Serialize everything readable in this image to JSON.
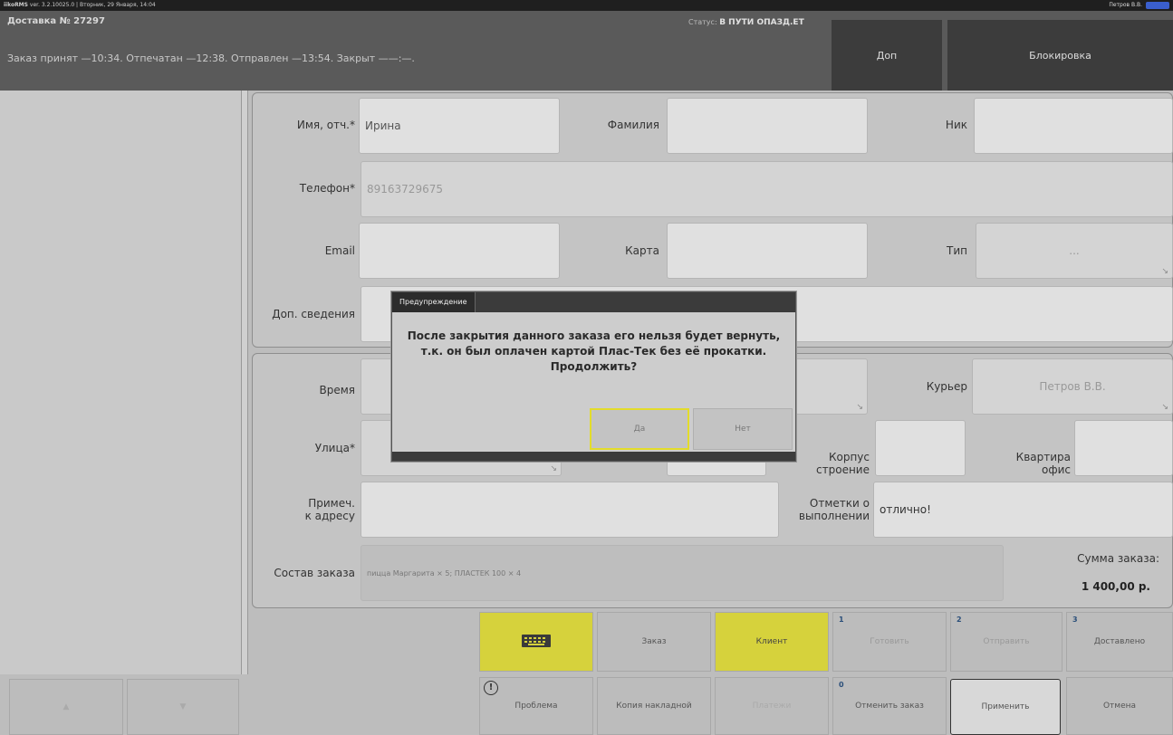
{
  "topbar": {
    "app": "iikoRMS",
    "version": "ver. 3.2.10025.0",
    "datetime": "Вторник, 29 Января, 14:04",
    "user": "Петров В.В."
  },
  "header": {
    "title": "Доставка № 27297",
    "times": "Заказ принят —10:34. Отпечатан —12:38. Отправлен —13:54. Закрыт ——:—.",
    "status_label": "Статус:",
    "status_value": "В ПУТИ ОПАЗД.ЕТ",
    "dop_label": "Доп",
    "block_label": "Блокировка"
  },
  "client": {
    "name_label": "Имя, отч.*",
    "name_value": "Ирина",
    "surname_label": "Фамилия",
    "surname_value": "",
    "nick_label": "Ник",
    "nick_value": "",
    "phone_label": "Телефон*",
    "phone_value": "89163729675",
    "email_label": "Email",
    "email_value": "",
    "card_label": "Карта",
    "card_value": "",
    "type_label": "Тип",
    "type_value": "...",
    "extra_label": "Доп. сведения",
    "extra_value": ""
  },
  "address": {
    "time_label": "Время",
    "courier_label": "Курьер",
    "courier_value": "Петров В.В.",
    "street_label": "Улица*",
    "korpus_label1": "Корпус",
    "korpus_label2": "строение",
    "kv_label1": "Квартира",
    "kv_label2": "офис",
    "note_label1": "Примеч.",
    "note_label2": "к адресу",
    "marks_label1": "Отметки о",
    "marks_label2": "выполнении",
    "marks_value": "отлично!",
    "composition_label": "Состав заказа",
    "composition_value": "пицца Маргарита × 5; ПЛАСТЕК 100 × 4",
    "sum_label": "Сумма заказа:",
    "sum_value": "1 400,00 р."
  },
  "buttons_row1": {
    "keyboard": "keyboard-icon",
    "order": "Заказ",
    "client": "Клиент",
    "cook_num": "1",
    "cook": "Готовить",
    "send_num": "2",
    "send": "Отправить",
    "delivered_num": "3",
    "delivered": "Доставлено"
  },
  "buttons_row2": {
    "up": "▲",
    "down": "▼",
    "problem": "Проблема",
    "problem_icon": "!",
    "copy": "Копия накладной",
    "payments": "Платежи",
    "cancel_order_num": "0",
    "cancel_order": "Отменить заказ",
    "apply": "Применить",
    "cancel": "Отмена"
  },
  "dialog": {
    "title": "Предупреждение",
    "line1": "После закрытия данного заказа его нельзя будет вернуть,",
    "line2": "т.к. он был оплачен картой Плас-Тек без её прокатки.",
    "line3": "Продолжить?",
    "yes": "Да",
    "no": "Нет"
  },
  "colors": {
    "accent_yellow": "#d6d23c",
    "header": "#5a5a5a",
    "dark_button": "#3c3c3c",
    "blue": "#3a5fcd"
  }
}
